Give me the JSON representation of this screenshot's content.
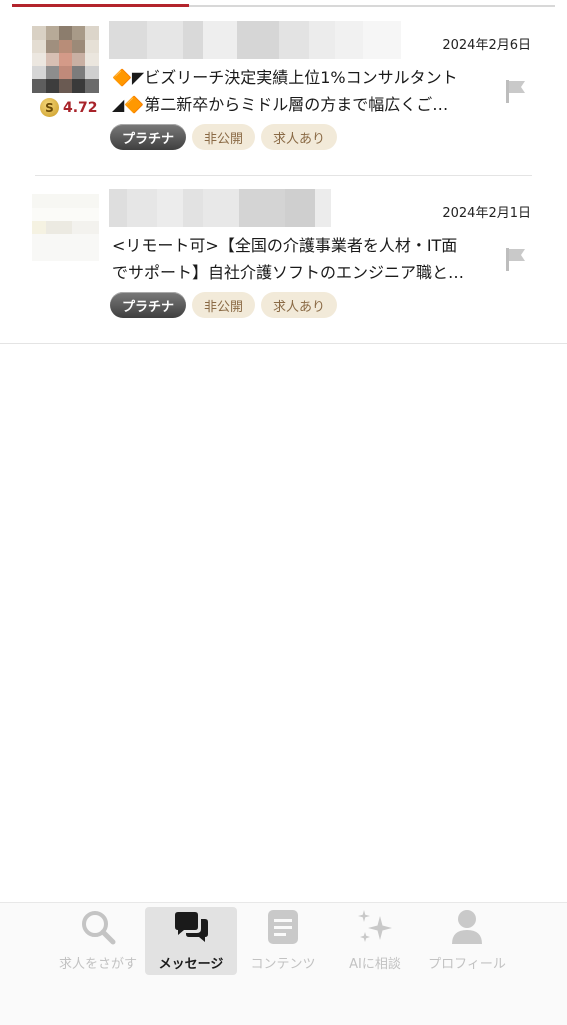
{
  "messages": [
    {
      "date": "2024年2月6日",
      "title_line1": "🔶◤ビズリーチ決定実績上位1%コンサルタント",
      "title_line2": "◢🔶第二新卒からミドル層の方まで幅広くご…",
      "rating_badge": "S",
      "rating": "4.72",
      "tags": [
        "プラチナ",
        "非公開",
        "求人あり"
      ]
    },
    {
      "date": "2024年2月1日",
      "title_line1": "<リモート可>【全国の介護事業者を人材・IT面",
      "title_line2": "でサポート】自社介護ソフトのエンジニア職と…",
      "tags": [
        "プラチナ",
        "非公開",
        "求人あり"
      ]
    }
  ],
  "tabbar": {
    "tabs": [
      {
        "label": "求人をさがす",
        "icon": "search-icon"
      },
      {
        "label": "メッセージ",
        "icon": "chat-bubbles-icon"
      },
      {
        "label": "コンテンツ",
        "icon": "document-icon"
      },
      {
        "label": "AIに相談",
        "icon": "sparkle-icon"
      },
      {
        "label": "プロフィール",
        "icon": "person-icon"
      }
    ],
    "active": "メッセージ"
  },
  "colors": {
    "accent": "#b3242c",
    "rating": "#a8232a",
    "tag_beige_bg": "#f2ead9",
    "tag_beige_text": "#8a6a45"
  }
}
